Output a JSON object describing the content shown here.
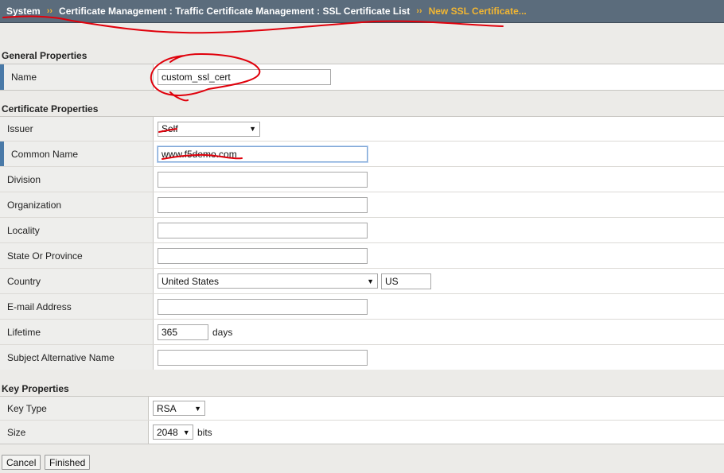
{
  "breadcrumb": {
    "items": [
      "System",
      "Certificate Management : Traffic Certificate Management : SSL Certificate List"
    ],
    "current": "New SSL Certificate...",
    "separator": "››"
  },
  "general": {
    "title": "General Properties",
    "name_label": "Name",
    "name_value": "custom_ssl_cert"
  },
  "certificate": {
    "title": "Certificate Properties",
    "issuer_label": "Issuer",
    "issuer_value": "Self",
    "common_name_label": "Common Name",
    "common_name_value": "www.f5demo.com",
    "division_label": "Division",
    "organization_label": "Organization",
    "locality_label": "Locality",
    "state_label": "State Or Province",
    "country_label": "Country",
    "country_value": "United States",
    "country_code": "US",
    "email_label": "E-mail Address",
    "lifetime_label": "Lifetime",
    "lifetime_value": "365",
    "lifetime_unit": "days",
    "san_label": "Subject Alternative Name"
  },
  "key": {
    "title": "Key Properties",
    "type_label": "Key Type",
    "type_value": "RSA",
    "size_label": "Size",
    "size_value": "2048",
    "size_unit": "bits"
  },
  "buttons": {
    "cancel": "Cancel",
    "finished": "Finished"
  },
  "colors": {
    "breadcrumb_bg": "#5b6c7c",
    "breadcrumb_current": "#f2b632",
    "required_marker": "#4a7aa8",
    "annotation": "#e0000b"
  }
}
